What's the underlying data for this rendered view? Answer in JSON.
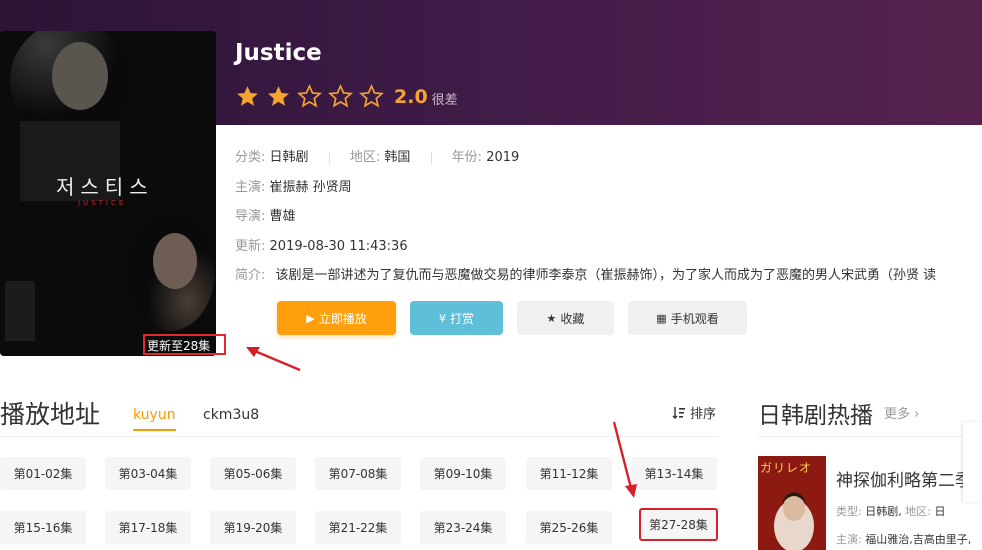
{
  "show": {
    "title": "Justice",
    "rating": 2.0,
    "rating_display": "2.0",
    "rating_label": "很差",
    "stars_filled": 2,
    "stars_total": 5,
    "update_badge": "更新至28集",
    "poster_title_kr": "저스티스",
    "poster_title_en": "JUSTICE"
  },
  "info": {
    "category_key": "分类:",
    "category_val": "日韩剧",
    "region_key": "地区:",
    "region_val": "韩国",
    "year_key": "年份:",
    "year_val": "2019",
    "cast_key": "主演:",
    "cast_val": "崔振赫 孙贤周",
    "director_key": "导演:",
    "director_val": "曹雄",
    "updated_key": "更新:",
    "updated_val": "2019-08-30 11:43:36",
    "summary_key": "简介:",
    "summary_val": "该剧是一部讲述为了复仇而与恶魔做交易的律师李泰京（崔振赫饰），为了家人而成为了恶魔的男人宋武勇（孙贤 读"
  },
  "buttons": {
    "play": "立即播放",
    "tip": "打赏",
    "favorite": "收藏",
    "mobile": "手机观看",
    "play_icon": "▶",
    "tip_icon": "¥",
    "favorite_icon": "★",
    "mobile_icon": "▦"
  },
  "playlist": {
    "title": "播放地址",
    "tabs": [
      "kuyun",
      "ckm3u8"
    ],
    "sort_label": "排序",
    "episodes": [
      "第01-02集",
      "第03-04集",
      "第05-06集",
      "第07-08集",
      "第09-10集",
      "第11-12集",
      "第13-14集",
      "第15-16集",
      "第17-18集",
      "第19-20集",
      "第21-22集",
      "第23-24集",
      "第25-26集",
      "第27-28集"
    ]
  },
  "sidebar": {
    "title": "日韩剧热播",
    "more": "更多",
    "more_icon": "›",
    "item_name": "神探伽利略第二季",
    "item_type_key": "类型:",
    "item_type_val": "日韩剧,",
    "item_region_key": "地区:",
    "item_region_val": "日",
    "item_cast_key": "主演:",
    "item_cast_val": "福山雅治,吉高由里子,",
    "thumb_text": "ガリレオ"
  },
  "colors": {
    "accent": "#ff9900",
    "play_btn": "#ff9f0e",
    "tip_btn": "#5fbfd8",
    "annotation_red": "#d8202a",
    "star": "#f7a331"
  }
}
